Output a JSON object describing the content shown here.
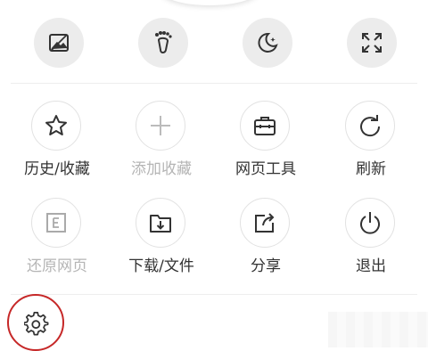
{
  "quick_actions": [
    {
      "name": "image-off-icon"
    },
    {
      "name": "footprint-icon"
    },
    {
      "name": "night-mode-icon"
    },
    {
      "name": "fullscreen-icon"
    }
  ],
  "grid": [
    {
      "label": "历史/收藏",
      "icon": "star-icon",
      "enabled": true
    },
    {
      "label": "添加收藏",
      "icon": "plus-icon",
      "enabled": false
    },
    {
      "label": "网页工具",
      "icon": "toolbox-icon",
      "enabled": true
    },
    {
      "label": "刷新",
      "icon": "refresh-icon",
      "enabled": true
    },
    {
      "label": "还原网页",
      "icon": "restore-page-icon",
      "enabled": false
    },
    {
      "label": "下载/文件",
      "icon": "download-folder-icon",
      "enabled": true
    },
    {
      "label": "分享",
      "icon": "share-icon",
      "enabled": true
    },
    {
      "label": "退出",
      "icon": "power-icon",
      "enabled": true
    }
  ],
  "bottom": {
    "settings_icon": "gear-icon",
    "highlight_color": "#c62828"
  }
}
